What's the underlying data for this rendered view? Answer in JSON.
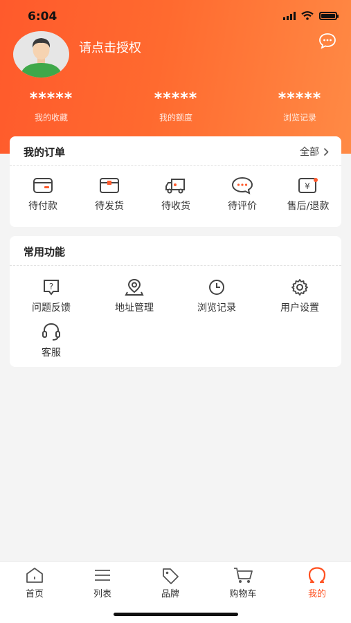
{
  "status": {
    "time": "6:04"
  },
  "profile": {
    "auth_text": "请点击授权"
  },
  "stats": [
    {
      "value": "*****",
      "label": "我的收藏"
    },
    {
      "value": "*****",
      "label": "我的额度"
    },
    {
      "value": "*****",
      "label": "浏览记录"
    }
  ],
  "orders": {
    "title": "我的订单",
    "all_label": "全部",
    "items": [
      {
        "label": "待付款",
        "icon": "wallet-icon"
      },
      {
        "label": "待发货",
        "icon": "box-icon"
      },
      {
        "label": "待收货",
        "icon": "truck-icon"
      },
      {
        "label": "待评价",
        "icon": "chat-bubble-icon"
      },
      {
        "label": "售后/退款",
        "icon": "refund-icon"
      }
    ]
  },
  "features": {
    "title": "常用功能",
    "items": [
      {
        "label": "问题反馈",
        "icon": "question-icon"
      },
      {
        "label": "地址管理",
        "icon": "location-icon"
      },
      {
        "label": "浏览记录",
        "icon": "clock-icon"
      },
      {
        "label": "用户设置",
        "icon": "gear-icon"
      },
      {
        "label": "客服",
        "icon": "headset-icon"
      }
    ]
  },
  "tabbar": {
    "items": [
      {
        "label": "首页",
        "icon": "home-icon"
      },
      {
        "label": "列表",
        "icon": "list-icon"
      },
      {
        "label": "品牌",
        "icon": "tag-icon"
      },
      {
        "label": "购物车",
        "icon": "cart-icon"
      },
      {
        "label": "我的",
        "icon": "user-icon",
        "active": true
      }
    ]
  },
  "colors": {
    "accent": "#ff5a2c",
    "active_tab": "#ff4f1e"
  }
}
